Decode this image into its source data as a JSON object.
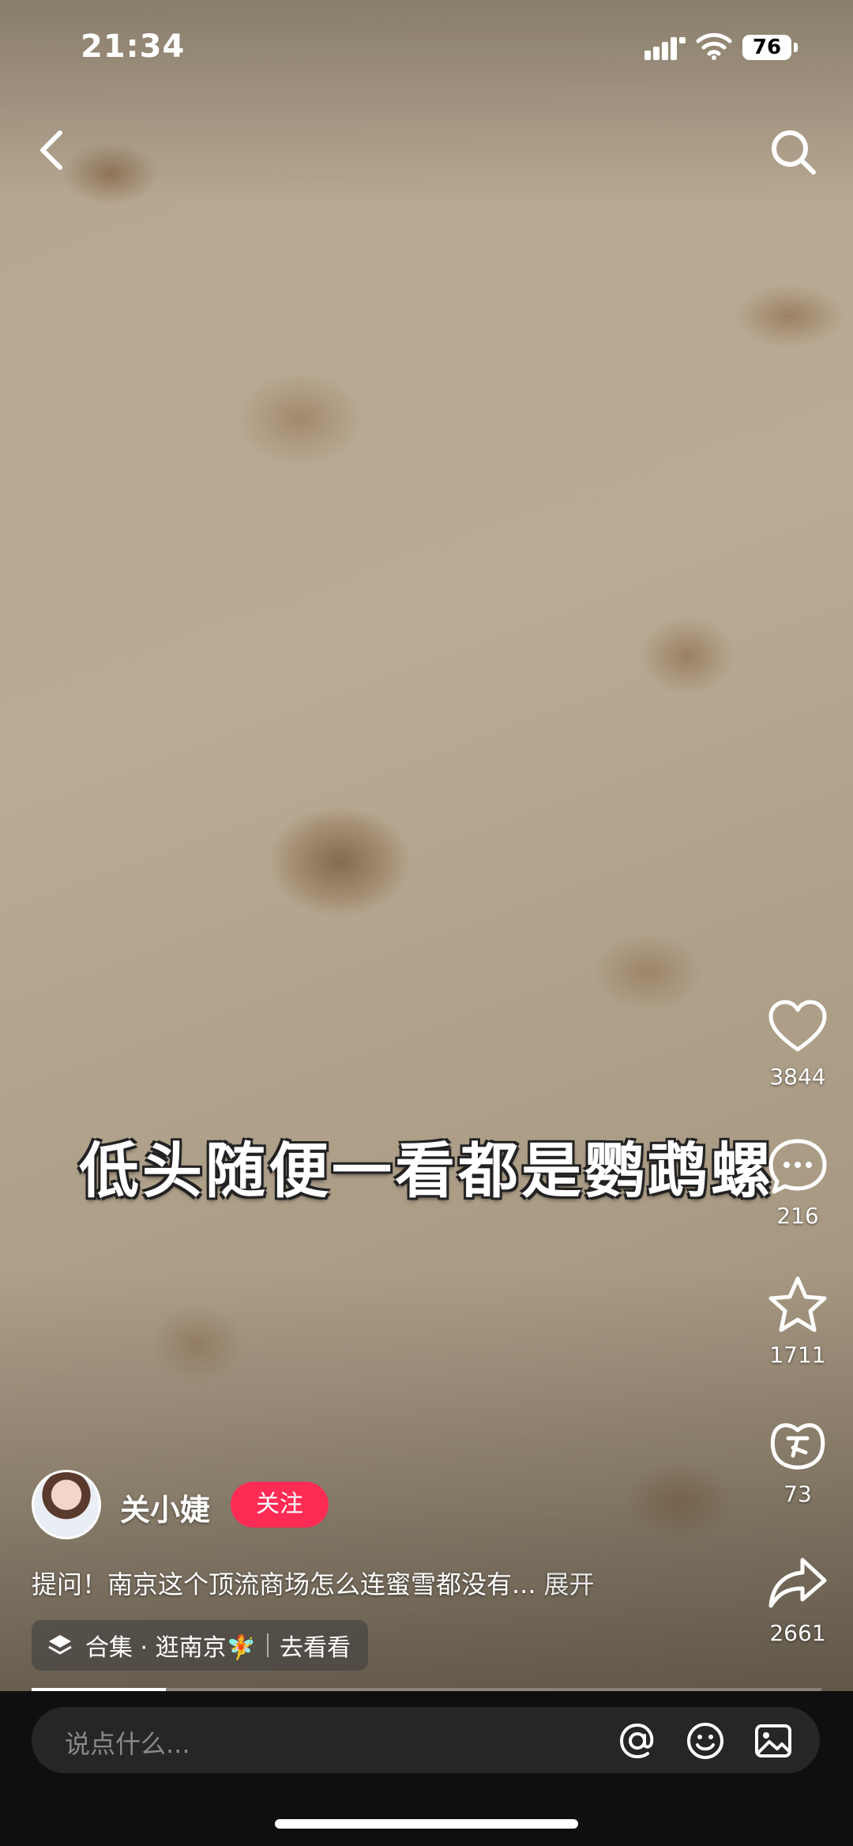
{
  "status_bar": {
    "time": "21:34",
    "battery": "76"
  },
  "video": {
    "subtitle": "低头随便一看都是鹦鹉螺"
  },
  "actions": {
    "likes": "3844",
    "comments": "216",
    "favorites": "1711",
    "gifts": "73",
    "shares": "2661"
  },
  "author": {
    "name": "关小婕",
    "follow_label": "关注"
  },
  "caption": {
    "text": "提问！南京这个顶流商场怎么连蜜雪都没有...",
    "more_label": "展开"
  },
  "collection": {
    "label": "合集 · 逛南京🧚",
    "action": "去看看"
  },
  "progress": {
    "fraction": 0.17
  },
  "comment_bar": {
    "placeholder": "说点什么..."
  },
  "colors": {
    "follow": "#fe2c55"
  }
}
